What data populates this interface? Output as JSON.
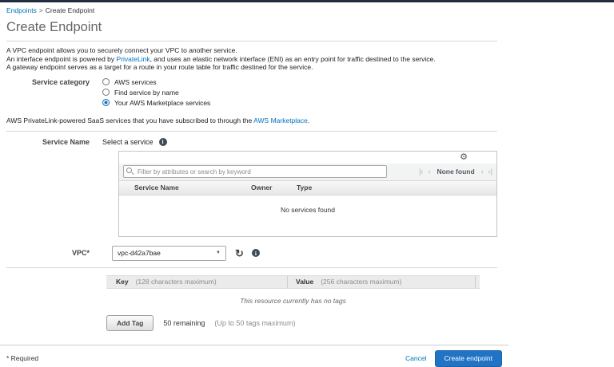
{
  "breadcrumb": {
    "parent": "Endpoints",
    "separator": ">",
    "current": "Create Endpoint"
  },
  "page": {
    "title": "Create Endpoint"
  },
  "intro": {
    "line1": "A VPC endpoint allows you to securely connect your VPC to another service.",
    "line2_pre": "An interface endpoint is powered by ",
    "line2_link": "PrivateLink",
    "line2_post": ", and uses an elastic network interface (ENI) as an entry point for traffic destined to the service.",
    "line3": "A gateway endpoint serves as a target for a route in your route table for traffic destined for the service."
  },
  "service_category": {
    "label": "Service category",
    "options": [
      {
        "label": "AWS services",
        "selected": false
      },
      {
        "label": "Find service by name",
        "selected": false
      },
      {
        "label": "Your AWS Marketplace services",
        "selected": true
      }
    ]
  },
  "marketplace_note": {
    "pre": "AWS PrivateLink-powered SaaS services that you have subscribed to through the ",
    "link": "AWS Marketplace",
    "post": "."
  },
  "service_name": {
    "label": "Service Name",
    "value": "Select a service"
  },
  "service_table": {
    "filter_placeholder": "Filter by attributes or search by keyword",
    "pagination_label": "None found",
    "columns": [
      "Service Name",
      "Owner",
      "Type"
    ],
    "empty_message": "No services found"
  },
  "vpc": {
    "label": "VPC*",
    "value": "vpc-d42a7bae"
  },
  "tags": {
    "key_header": "Key",
    "key_hint": "(128 characters maximum)",
    "value_header": "Value",
    "value_hint": "(256 characters maximum)",
    "empty_message": "This resource currently has no tags",
    "add_button": "Add Tag",
    "remaining": "50 remaining",
    "max_hint": "(Up to 50 tags maximum)"
  },
  "footer": {
    "required_note": "* Required",
    "cancel": "Cancel",
    "submit": "Create endpoint"
  },
  "icons": {
    "info": "i",
    "gear": "⚙",
    "caret": "▼",
    "refresh": "↻",
    "page_first": "|‹",
    "page_prev": "‹",
    "page_next": "›",
    "page_last": "›|"
  },
  "colors": {
    "link": "#0073bb",
    "primary_button": "#2173c4",
    "topbar": "#232f3e"
  }
}
